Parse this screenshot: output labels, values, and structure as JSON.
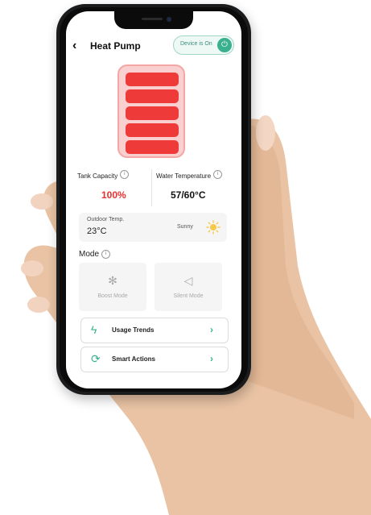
{
  "header": {
    "back_icon": "chevron-left-icon",
    "title": "Heat Pump"
  },
  "device_toggle": {
    "label": "Device is On",
    "state": "on",
    "icon": "power-icon",
    "color": "#3bb08f"
  },
  "battery": {
    "icon": "tank-level-icon",
    "segments_filled": 5,
    "segments_total": 5,
    "fill_color": "#ee3b39"
  },
  "stats": {
    "tank_capacity": {
      "label": "Tank Capacity",
      "value": "100%",
      "value_color": "#e8302e"
    },
    "water_temperature": {
      "label": "Water Temperature",
      "value": "57/60°C"
    }
  },
  "outdoor": {
    "label": "Outdoor Temp.",
    "temp": "23°C",
    "condition": "Sunny",
    "icon": "sun-icon"
  },
  "mode": {
    "title": "Mode",
    "options": [
      {
        "label": "Boost Mode",
        "icon": "fan-icon"
      },
      {
        "label": "Silent Mode",
        "icon": "speaker-icon"
      }
    ]
  },
  "actions": [
    {
      "label": "Usage Trends",
      "icon": "lightning-icon"
    },
    {
      "label": "Smart Actions",
      "icon": "refresh-icon"
    }
  ]
}
